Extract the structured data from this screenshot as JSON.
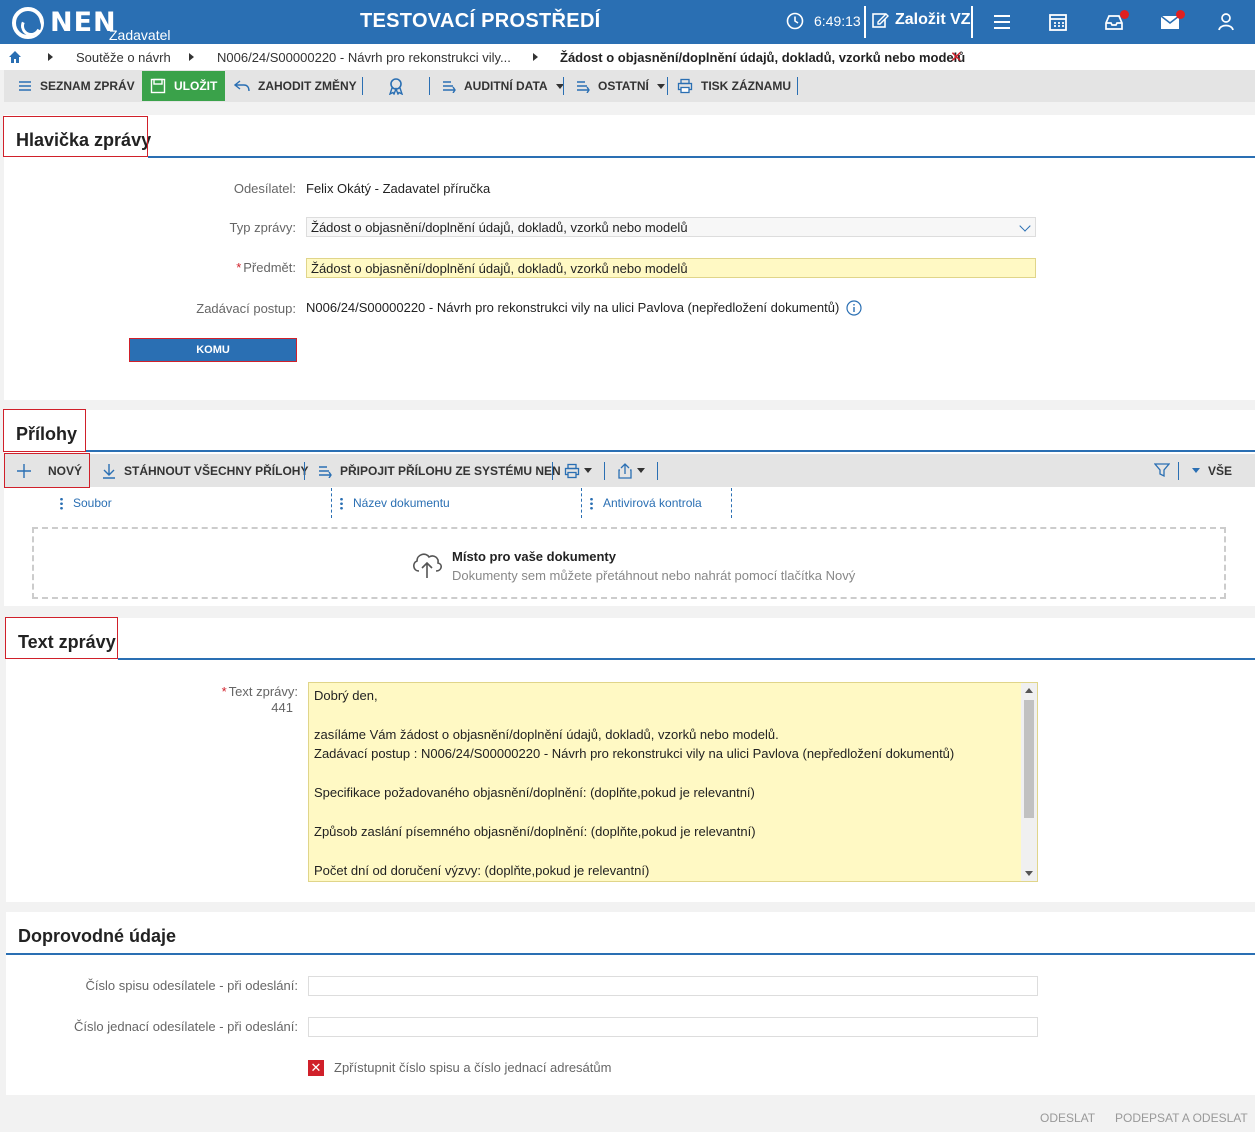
{
  "header": {
    "logo_text": "NEN",
    "logo_sub": "Zadavatel",
    "env_title": "TESTOVACÍ PROSTŘEDÍ",
    "clock": "6:49:13",
    "create_label": "Založit VZ"
  },
  "breadcrumb": {
    "items": [
      "Soutěže o návrh",
      "N006/24/S00000220 - Návrh pro rekonstrukci vily...",
      "Žádost o objasnění/doplnění údajů, dokladů, vzorků nebo modelů"
    ]
  },
  "toolbar": {
    "list_label": "SEZNAM ZPRÁV",
    "save_label": "ULOŽIT",
    "discard_label": "ZAHODIT ZMĚNY",
    "audit_label": "AUDITNÍ DATA",
    "other_label": "OSTATNÍ",
    "print_label": "TISK ZÁZNAMU"
  },
  "message_header": {
    "title": "Hlavička zprávy",
    "sender_label": "Odesílatel:",
    "sender_value": "Felix Okátý - Zadavatel příručka",
    "type_label": "Typ zprávy:",
    "type_value": "Žádost o objasnění/doplnění údajů, dokladů, vzorků nebo modelů",
    "subject_label": "Předmět:",
    "subject_value": "Žádost o objasnění/doplnění údajů, dokladů, vzorků nebo modelů",
    "procedure_label": "Zadávací postup:",
    "procedure_value": "N006/24/S00000220 - Návrh pro rekonstrukci vily na ulici Pavlova (nepředložení dokumentů)",
    "to_button": "KOMU"
  },
  "attachments": {
    "title": "Přílohy",
    "new_label": "NOVÝ",
    "download_all_label": "STÁHNOUT VŠECHNY PŘÍLOHY",
    "attach_label": "PŘIPOJIT PŘÍLOHU ZE SYSTÉMU NEN",
    "all_label": "VŠE",
    "columns": [
      "Soubor",
      "Název dokumentu",
      "Antivirová kontrola"
    ],
    "dropzone_title": "Místo pro vaše dokumenty",
    "dropzone_hint": "Dokumenty sem můžete přetáhnout nebo nahrát pomocí tlačítka Nový"
  },
  "message_text": {
    "title": "Text zprávy",
    "label": "Text zprávy:",
    "count": "441",
    "lines": [
      "Dobrý den,",
      "",
      "zasíláme Vám žádost o objasnění/doplnění údajů, dokladů, vzorků nebo modelů.",
      "Zadávací postup : N006/24/S00000220 - Návrh pro rekonstrukci vily na ulici Pavlova (nepředložení dokumentů)",
      "",
      "Specifikace požadovaného objasnění/doplnění: (doplňte,pokud je relevantní)",
      "",
      "Způsob zaslání písemného objasnění/doplnění: (doplňte,pokud je relevantní)",
      "",
      "Počet dní od doručení výzvy: (doplňte,pokud je relevantní)"
    ]
  },
  "accompanying": {
    "title": "Doprovodné údaje",
    "file_no_label": "Číslo spisu odesílatele - při odeslání:",
    "file_no_value": "",
    "ref_no_label": "Číslo jednací odesílatele - při odeslání:",
    "ref_no_value": "",
    "share_label": "Zpřístupnit číslo spisu a číslo jednací adresátům",
    "share_checked": false
  },
  "footer": {
    "send_label": "ODESLAT",
    "sign_send_label": "PODEPSAT A ODESLAT"
  },
  "colors": {
    "brand": "#2a6fb3",
    "save": "#3aa24a",
    "required_field": "#fff9c4",
    "alert": "#d0202a"
  }
}
